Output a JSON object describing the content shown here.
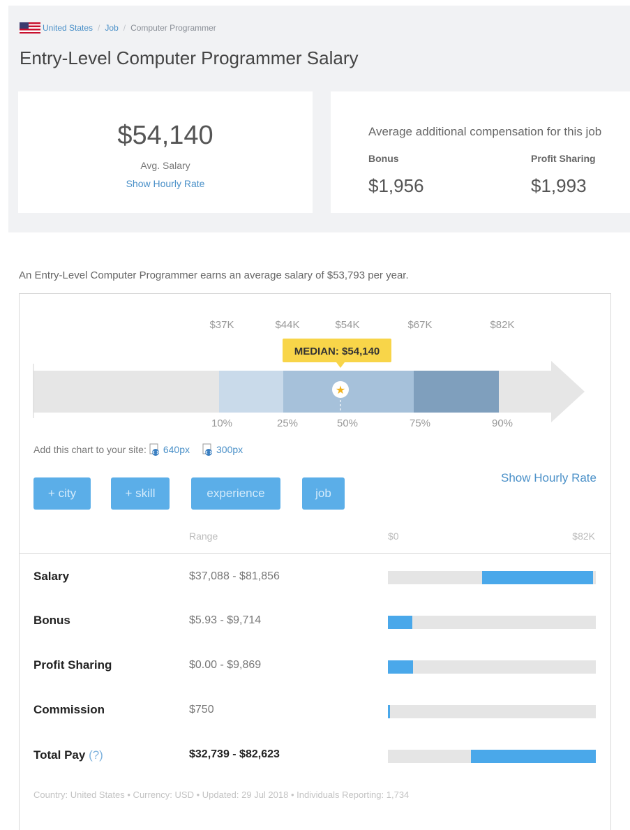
{
  "breadcrumb": {
    "country": "United States",
    "separator": "/",
    "category": "Job",
    "current": "Computer Programmer"
  },
  "page_title": "Entry-Level Computer Programmer Salary",
  "salary_card": {
    "value": "$54,140",
    "label": "Avg. Salary",
    "hourly_link": "Show Hourly Rate"
  },
  "comp_card": {
    "title": "Average additional compensation for this job",
    "items": [
      {
        "label": "Bonus",
        "value": "$1,956"
      },
      {
        "label": "Profit Sharing",
        "value": "$1,993"
      }
    ]
  },
  "summary": "An Entry-Level Computer Programmer earns an average salary of $53,793 per year.",
  "chart_data": {
    "type": "bar",
    "description_free": true,
    "value_labels": [
      "$37K",
      "$44K",
      "$54K",
      "$67K",
      "$82K"
    ],
    "percentile_labels": [
      "10%",
      "25%",
      "50%",
      "75%",
      "90%"
    ],
    "values": [
      37,
      44,
      54,
      67,
      82
    ],
    "unit_scale": "K",
    "median_label": "MEDIAN: $54,140",
    "median_value": 54140,
    "colors": {
      "track": "#e6e6e6",
      "band_outer": "#c9daea",
      "band_inner": "#a6c1da",
      "band_upper": "#7f9fbd",
      "tooltip": "#f8d549"
    }
  },
  "embed": {
    "label": "Add this chart to your site:",
    "links": [
      "640px",
      "300px"
    ]
  },
  "filters": {
    "buttons": [
      "+ city",
      "+ skill",
      "experience",
      "job"
    ],
    "hourly_link": "Show Hourly Rate"
  },
  "table": {
    "headers": {
      "range": "Range",
      "min": "$0",
      "max": "$82K"
    },
    "scale_max": 82000,
    "rows": [
      {
        "label": "Salary",
        "range": "$37,088 - $81,856",
        "min": 37088,
        "max": 81856
      },
      {
        "label": "Bonus",
        "range": "$5.93 - $9,714",
        "min": 0,
        "max": 9714
      },
      {
        "label": "Profit Sharing",
        "range": "$0.00 - $9,869",
        "min": 0,
        "max": 9869
      },
      {
        "label": "Commission",
        "range": "$750",
        "min": 0,
        "max": 750
      },
      {
        "label": "Total Pay",
        "help": "(?)",
        "range": "$32,739 - $82,623",
        "min": 32739,
        "max": 82623,
        "bold": true
      }
    ]
  },
  "footer": "Country: United States • Currency: USD • Updated: 29 Jul 2018 • Individuals Reporting: 1,734"
}
